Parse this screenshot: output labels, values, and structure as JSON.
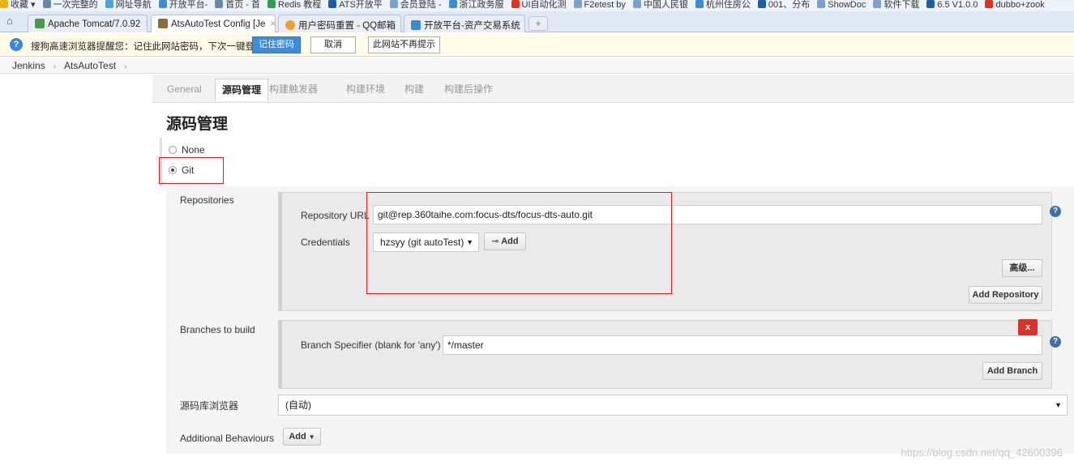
{
  "bookmarks": [
    {
      "label": "收藏 ▾",
      "icon": "star-icon",
      "color": "#f0b400"
    },
    {
      "label": "一次完整的",
      "icon": "link-icon",
      "color": "#6688aa"
    },
    {
      "label": "网址导航",
      "icon": "globe-icon",
      "color": "#4aa0d8"
    },
    {
      "label": "开放平台-",
      "icon": "platform-icon",
      "color": "#3b8bd0"
    },
    {
      "label": "首页 - 首",
      "icon": "link-icon",
      "color": "#6688aa"
    },
    {
      "label": "Redis 教程",
      "icon": "redis-icon",
      "color": "#2aa050"
    },
    {
      "label": "ATS开放平",
      "icon": "x-logo-icon",
      "color": "#1a5fa8"
    },
    {
      "label": "会员登陆 -",
      "icon": "page-icon",
      "color": "#7aa0d0"
    },
    {
      "label": "浙江政务服",
      "icon": "gov-icon",
      "color": "#3b8bd0"
    },
    {
      "label": "UI自动化测",
      "icon": "csdn-icon",
      "color": "#e03020"
    },
    {
      "label": "F2etest by",
      "icon": "page-icon",
      "color": "#7aa0d0"
    },
    {
      "label": "中国人民银",
      "icon": "page-icon",
      "color": "#7aa0d0"
    },
    {
      "label": "杭州住房公",
      "icon": "gov-icon",
      "color": "#3b8bd0"
    },
    {
      "label": "001、分布",
      "icon": "x-logo-icon",
      "color": "#1a5fa8"
    },
    {
      "label": "ShowDoc",
      "icon": "page-icon",
      "color": "#7aa0d0"
    },
    {
      "label": "软件下载",
      "icon": "page-icon",
      "color": "#7aa0d0"
    },
    {
      "label": "6.5 V1.0.0",
      "icon": "x-logo-icon",
      "color": "#1a5fa8"
    },
    {
      "label": "dubbo+zook",
      "icon": "csdn-icon",
      "color": "#e03020"
    }
  ],
  "browser_tabs": [
    {
      "label": "Apache Tomcat/7.0.92",
      "color": "#4a9a4a"
    },
    {
      "label": "AtsAutoTest Config [Je",
      "color": "#8a6d3b"
    },
    {
      "label": "用户密码重置 - QQ邮箱",
      "color": "#f0a030"
    },
    {
      "label": "开放平台-资产交易系统",
      "color": "#3b8bd0"
    }
  ],
  "password_bar": {
    "message": "搜狗高速浏览器提醒您：记住此网站密码，下次一键登录！",
    "remember": "记住密码",
    "cancel": "取消",
    "never": "此网站不再提示"
  },
  "breadcrumb": {
    "root": "Jenkins",
    "job": "AtsAutoTest"
  },
  "config_tabs": [
    "General",
    "源码管理",
    "构建触发器",
    "构建环境",
    "构建",
    "构建后操作"
  ],
  "section_title": "源码管理",
  "scm": {
    "none_label": "None",
    "git_label": "Git",
    "selected": "Git"
  },
  "repositories": {
    "label": "Repositories",
    "url_label": "Repository URL",
    "url_value": "git@rep.360taihe.com:focus-dts/focus-dts-auto.git",
    "credentials_label": "Credentials",
    "credentials_value": "hzsyy (git autoTest)",
    "add_label": "Add",
    "advanced_label": "高级...",
    "add_repo_label": "Add Repository"
  },
  "branches": {
    "label": "Branches to build",
    "delete_label": "x",
    "specifier_label": "Branch Specifier (blank for 'any')",
    "specifier_value": "*/master",
    "add_branch_label": "Add Branch"
  },
  "browser_field": {
    "label": "源码库浏览器",
    "value": "(自动)"
  },
  "behaviours": {
    "label": "Additional Behaviours",
    "add_label": "Add"
  },
  "help_glyph": "?",
  "watermark": "https://blog.csdn.net/qq_42600396",
  "colors": {
    "highlight": "#e02020",
    "accent": "#3c8cdc",
    "delete": "#d9342b"
  }
}
